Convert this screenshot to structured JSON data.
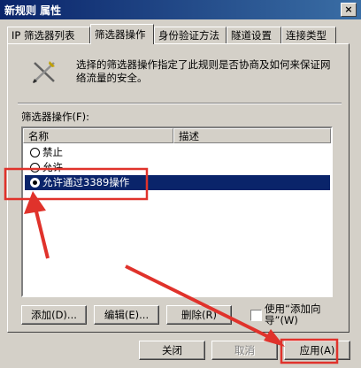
{
  "window": {
    "title": "新规则 属性",
    "close_glyph": "×"
  },
  "tabs": [
    {
      "label": "IP 筛选器列表",
      "active": false
    },
    {
      "label": "筛选器操作",
      "active": true
    },
    {
      "label": "身份验证方法",
      "active": false
    },
    {
      "label": "隧道设置",
      "active": false
    },
    {
      "label": "连接类型",
      "active": false
    }
  ],
  "description": "选择的筛选器操作指定了此规则是否协商及如何来保证网络流量的安全。",
  "list": {
    "label": "筛选器操作(F):",
    "columns": [
      "名称",
      "描述"
    ],
    "rows": [
      {
        "name": "禁止",
        "description": "",
        "selected": false
      },
      {
        "name": "允许",
        "description": "",
        "selected": false
      },
      {
        "name": "允许通过3389操作",
        "description": "",
        "selected": true
      }
    ]
  },
  "buttons": {
    "add": "添加(D)...",
    "edit": "编辑(E)...",
    "delete": "删除(R)",
    "close": "关闭",
    "cancel": "取消",
    "apply": "应用(A)"
  },
  "wizard_checkbox": {
    "label": "使用“添加向导”(W)",
    "checked": false
  },
  "colors": {
    "annotation": "#e0322b",
    "selection": "#0a246a",
    "titlebar": "#0a246a"
  },
  "icons": {
    "security_icon": "crossed-tools-icon"
  }
}
